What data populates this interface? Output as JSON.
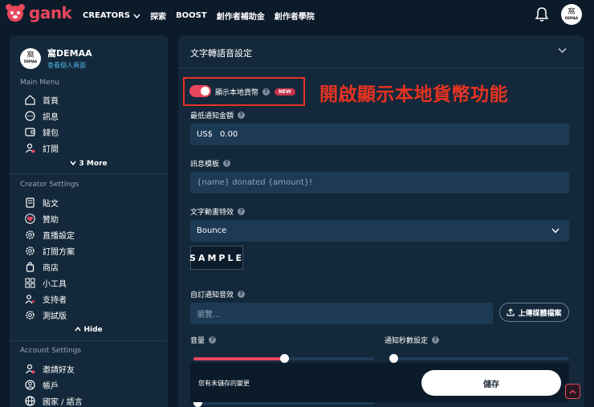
{
  "brand": {
    "name": "gank",
    "accent": "#e8475c"
  },
  "topnav": {
    "creators": "CREATORS",
    "explore": "探索",
    "boost": "BOOST",
    "fund": "創作者補助金",
    "academy": "創作者學院"
  },
  "avatar_text": {
    "glyph": "窩",
    "sub": "DEMAA"
  },
  "profile": {
    "name": "窩DEMAA",
    "link": "查看個人頁面"
  },
  "main_menu": {
    "title": "Main Menu",
    "items": [
      {
        "label": "首頁",
        "icon": "home-icon"
      },
      {
        "label": "訊息",
        "icon": "chat-icon"
      },
      {
        "label": "錢包",
        "icon": "wallet-icon"
      },
      {
        "label": "訂閱",
        "icon": "user-plus-icon"
      }
    ],
    "more": "3 More"
  },
  "creator_settings": {
    "title": "Creator Settings",
    "items": [
      {
        "label": "貼文",
        "icon": "post-icon"
      },
      {
        "label": "贊助",
        "icon": "heart-icon"
      },
      {
        "label": "直播設定",
        "icon": "stream-gear-icon"
      },
      {
        "label": "訂閱方案",
        "icon": "gear-icon"
      },
      {
        "label": "商店",
        "icon": "shop-icon"
      },
      {
        "label": "小工具",
        "icon": "widgets-icon"
      },
      {
        "label": "支持者",
        "icon": "supporters-icon"
      },
      {
        "label": "測試版",
        "icon": "beta-icon"
      }
    ],
    "hide": "Hide"
  },
  "account_settings": {
    "title": "Account Settings",
    "items": [
      {
        "label": "邀請好友",
        "icon": "invite-icon"
      },
      {
        "label": "帳戶",
        "icon": "account-icon"
      },
      {
        "label": "國家 / 語言",
        "icon": "globe-icon"
      }
    ]
  },
  "panel": {
    "title": "文字轉語音設定",
    "local_currency": {
      "label": "顯示本地貨幣",
      "badge": "NEW",
      "enabled": true
    },
    "annotation": "開啟顯示本地貨幣功能",
    "min_amount": {
      "label": "最低通知金額",
      "currency": "US$",
      "value": "0.00"
    },
    "template": {
      "label": "訊息模板",
      "value": "{name} donated {amount}!"
    },
    "animation": {
      "label": "文字動畫特效",
      "value": "Bounce",
      "sample": "SAMPLE"
    },
    "sound": {
      "label": "自訂通知音效",
      "placeholder": "瀏覽...",
      "upload": "上傳媒體檔案"
    },
    "volume": {
      "label": "音量",
      "level": 0.5
    },
    "duration": {
      "label": "通知秒數設定",
      "level": 0.02
    }
  },
  "savebar": {
    "message": "您有未儲存的變更",
    "save": "儲存"
  }
}
